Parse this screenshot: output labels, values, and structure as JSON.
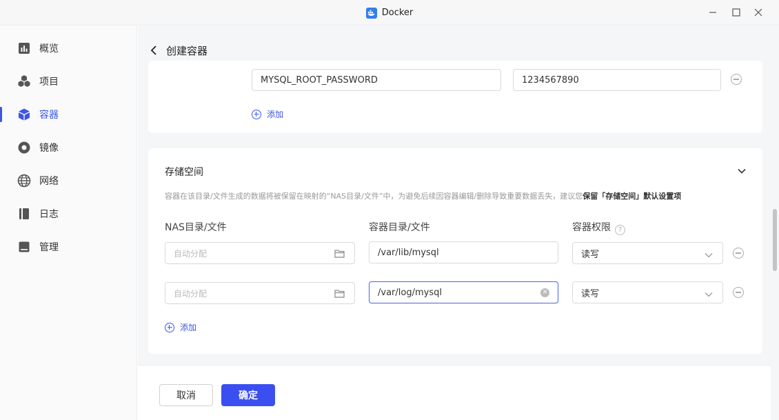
{
  "window": {
    "title": "Docker"
  },
  "sidebar": {
    "items": [
      {
        "label": "概览",
        "icon": "overview-icon"
      },
      {
        "label": "项目",
        "icon": "project-icon"
      },
      {
        "label": "容器",
        "icon": "container-icon",
        "active": true
      },
      {
        "label": "镜像",
        "icon": "image-icon"
      },
      {
        "label": "网络",
        "icon": "globe-icon"
      },
      {
        "label": "日志",
        "icon": "log-icon"
      },
      {
        "label": "管理",
        "icon": "manage-icon"
      }
    ]
  },
  "header": {
    "title": "创建容器"
  },
  "env": {
    "key_value": "MYSQL_ROOT_PASSWORD",
    "val_value": "1234567890",
    "add_label": "添加"
  },
  "storage": {
    "title": "存储空间",
    "hint_text": "容器在该目录/文件生成的数据将被保留在映射的“NAS目录/文件”中，为避免后续因容器编辑/删除导致重要数据丢失，建议您",
    "hint_bold": "保留「存储空间」默认设置项",
    "col_nas": "NAS目录/文件",
    "col_container": "容器目录/文件",
    "col_perm": "容器权限",
    "help_glyph": "?",
    "rows": [
      {
        "nas_placeholder": "自动分配",
        "container_path": "/var/lib/mysql",
        "permission": "读写"
      },
      {
        "nas_placeholder": "自动分配",
        "container_path": "/var/log/mysql",
        "permission": "读写"
      }
    ],
    "add_label": "添加"
  },
  "footer": {
    "cancel_label": "取消",
    "ok_label": "确定"
  },
  "colors": {
    "accent": "#3b55e6",
    "primary_button": "#3b4ff0",
    "docker_blue": "#2f7ff0"
  }
}
